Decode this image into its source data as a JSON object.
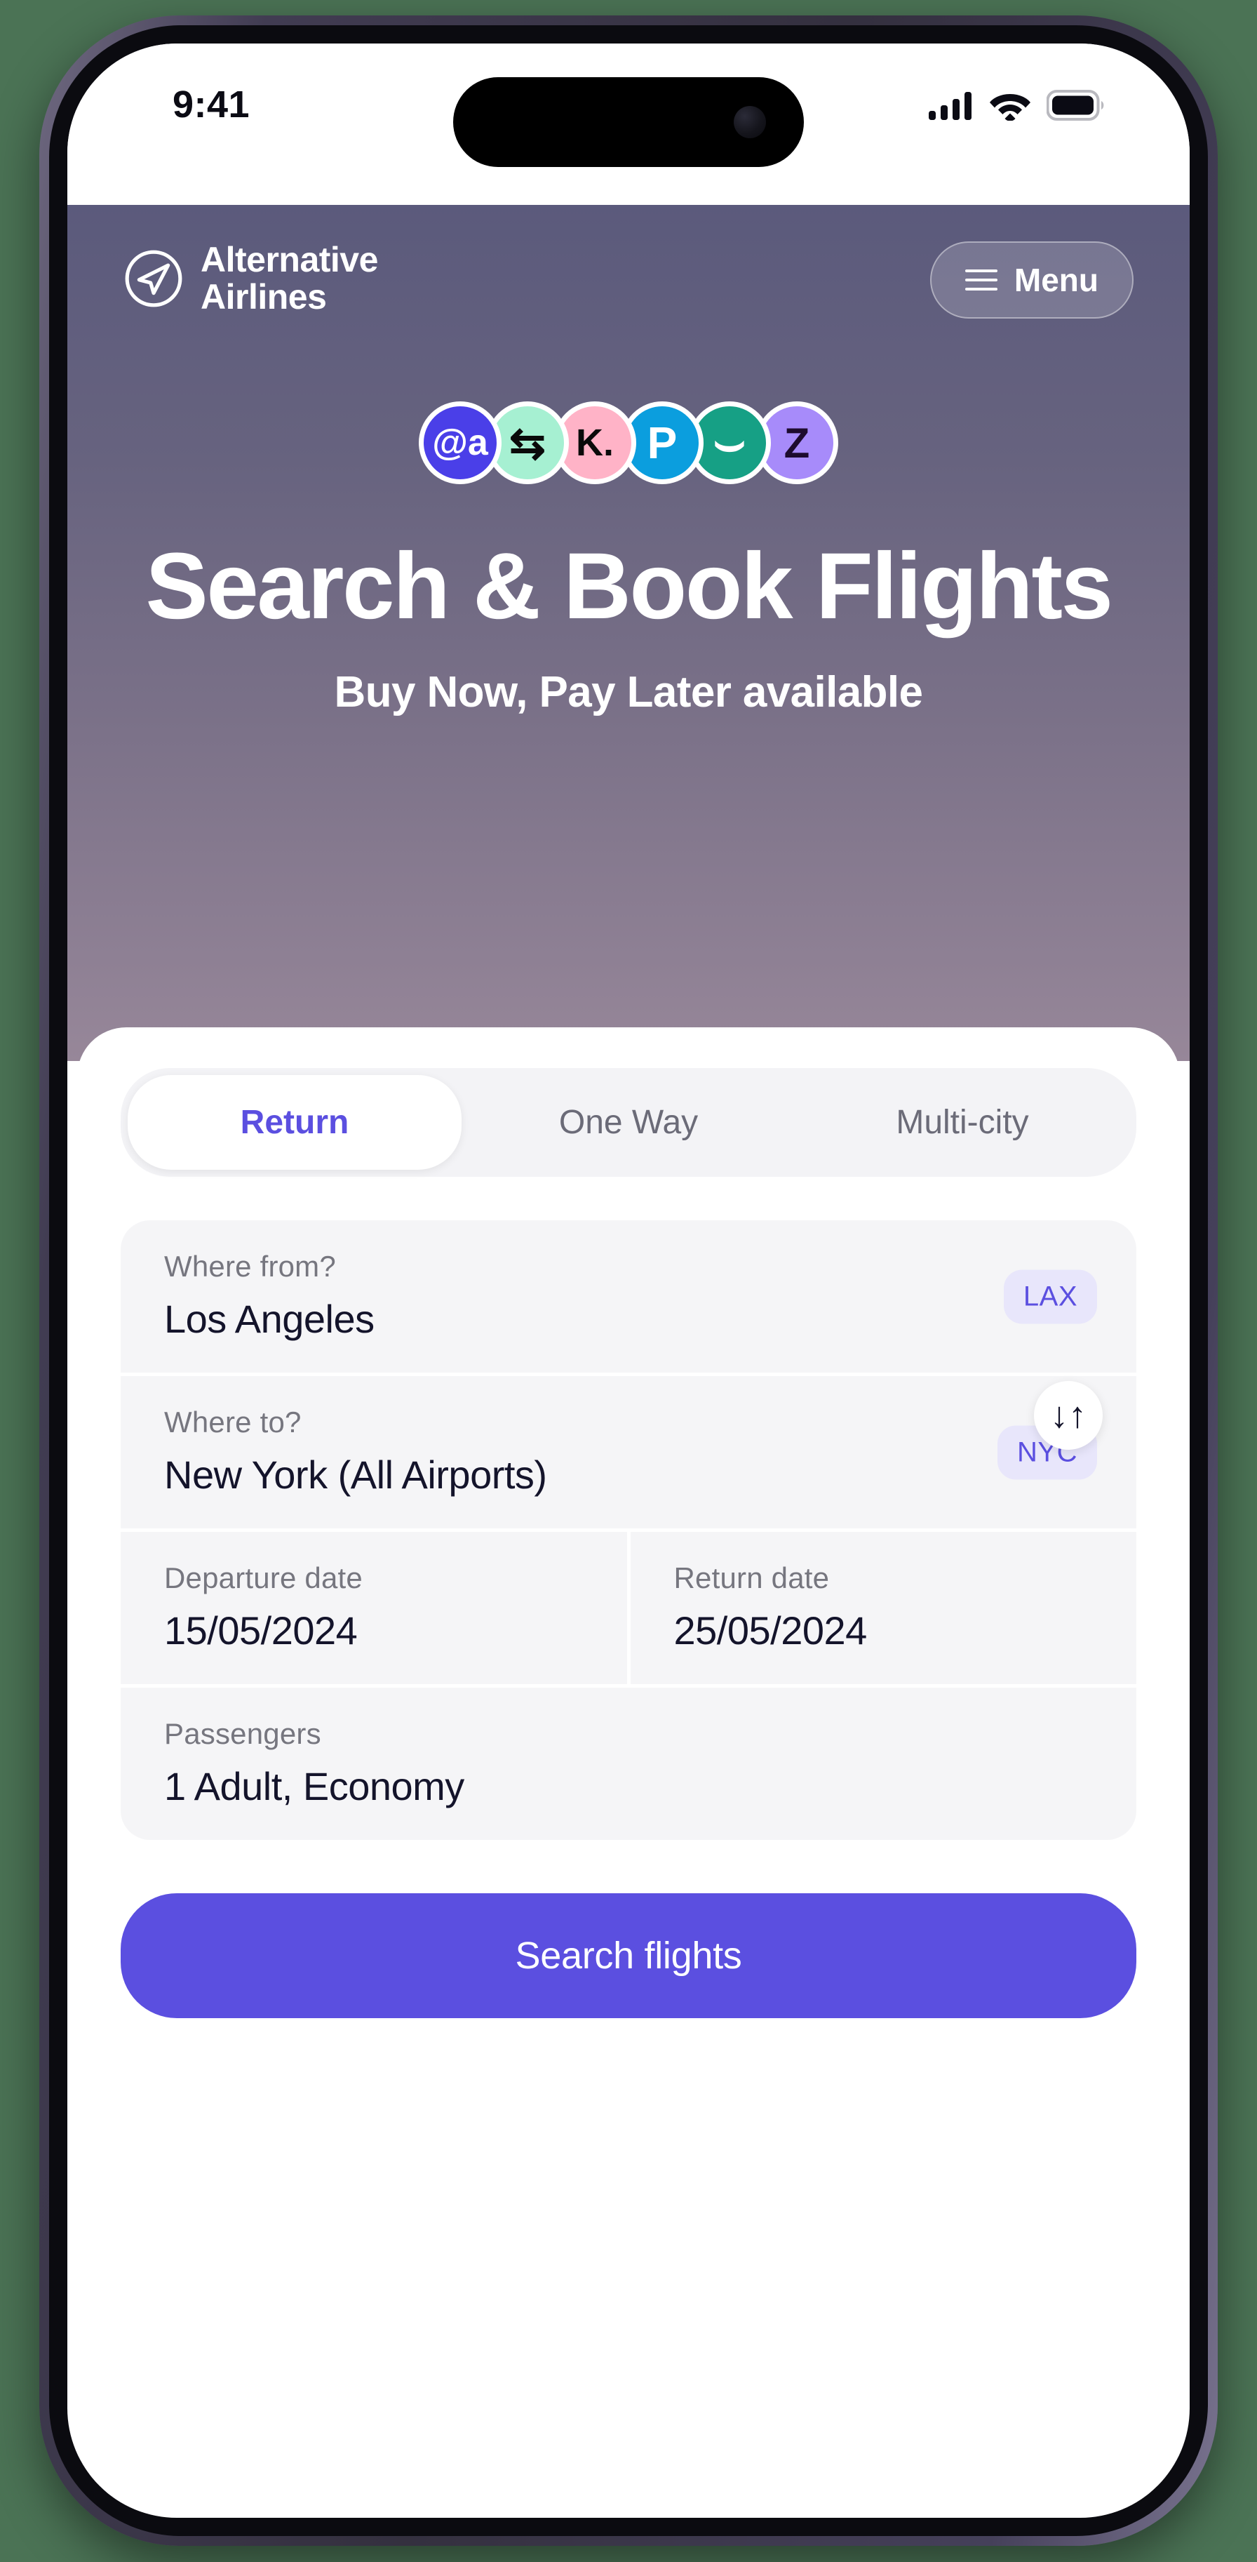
{
  "theme": {
    "page_background": "#4b7355",
    "accent": "#5b4fe0",
    "chip_bg": "#e8e6fb",
    "hero_gradient_top": "#5b5a7c",
    "hero_gradient_bottom": "#978799",
    "field_bg": "#f5f5f7",
    "tabbar_bg": "#f3f3f6"
  },
  "status_bar": {
    "time": "9:41",
    "cellular_icon": "cellular-signal-icon",
    "wifi_icon": "wifi-icon",
    "battery_icon": "battery-full-icon"
  },
  "header": {
    "logo_icon": "paper-plane-circle-icon",
    "brand_line1": "Alternative",
    "brand_line2": "Airlines",
    "menu_label": "Menu",
    "menu_icon": "hamburger-menu-icon"
  },
  "payment_badges": [
    {
      "name": "affirm",
      "glyph": "@a",
      "bg": "#4a3fe8",
      "fg": "#ffffff",
      "font_size": "52px"
    },
    {
      "name": "afterpay",
      "glyph": "⇆",
      "bg": "#a6f0d2",
      "fg": "#0a0a0a",
      "font_size": "62px"
    },
    {
      "name": "klarna",
      "glyph": "K.",
      "bg": "#ffb3c7",
      "fg": "#0a0a0a",
      "font_size": "54px"
    },
    {
      "name": "paypal",
      "glyph": "P",
      "bg": "#0b9ede",
      "fg": "#ffffff",
      "font_size": "64px"
    },
    {
      "name": "clearpay",
      "glyph": "⌣",
      "bg": "#16a085",
      "fg": "#ffffff",
      "font_size": "72px"
    },
    {
      "name": "zip",
      "glyph": "Z",
      "bg": "#a78bfa",
      "fg": "#1d0b2e",
      "font_size": "60px"
    }
  ],
  "hero": {
    "title": "Search & Book Flights",
    "subtitle": "Buy Now, Pay Later available"
  },
  "search_form": {
    "tabs": [
      {
        "label": "Return",
        "active": true
      },
      {
        "label": "One Way",
        "active": false
      },
      {
        "label": "Multi-city",
        "active": false
      }
    ],
    "origin": {
      "label": "Where from?",
      "value": "Los Angeles",
      "code": "LAX"
    },
    "destination": {
      "label": "Where to?",
      "value": "New York (All Airports)",
      "code": "NYC"
    },
    "swap_icon": "↓↑",
    "departure": {
      "label": "Departure date",
      "value": "15/05/2024"
    },
    "return": {
      "label": "Return date",
      "value": "25/05/2024"
    },
    "passengers": {
      "label": "Passengers",
      "value": "1 Adult, Economy"
    },
    "submit_label": "Search flights"
  }
}
